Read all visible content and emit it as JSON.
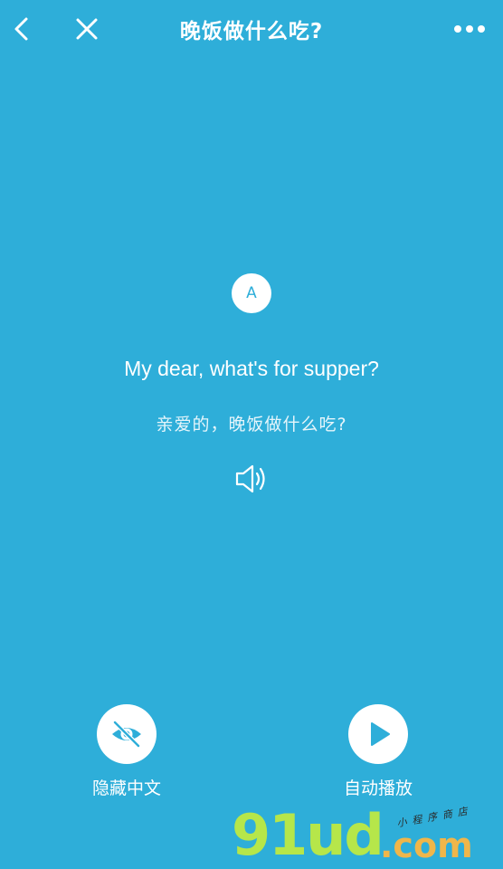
{
  "header": {
    "title": "晚饭做什么吃?",
    "back_icon": "chevron-left-icon",
    "close_icon": "close-icon",
    "more_icon": "more-dots-icon"
  },
  "dialogue": {
    "speaker": "A",
    "sentence_en": "My dear, what's for supper?",
    "sentence_zh": "亲爱的，晚饭做什么吃?",
    "audio_icon": "speaker-icon"
  },
  "actions": {
    "hide_chinese": {
      "label": "隐藏中文",
      "icon": "eye-off-icon"
    },
    "auto_play": {
      "label": "自动播放",
      "icon": "play-icon"
    }
  },
  "watermark": {
    "main": "91ud",
    "suffix": ".com",
    "sub": "小程序商店"
  },
  "colors": {
    "background": "#2eaed9",
    "foreground": "#ffffff",
    "watermark_green": "#b6e64a",
    "watermark_orange": "#f0b64a"
  }
}
